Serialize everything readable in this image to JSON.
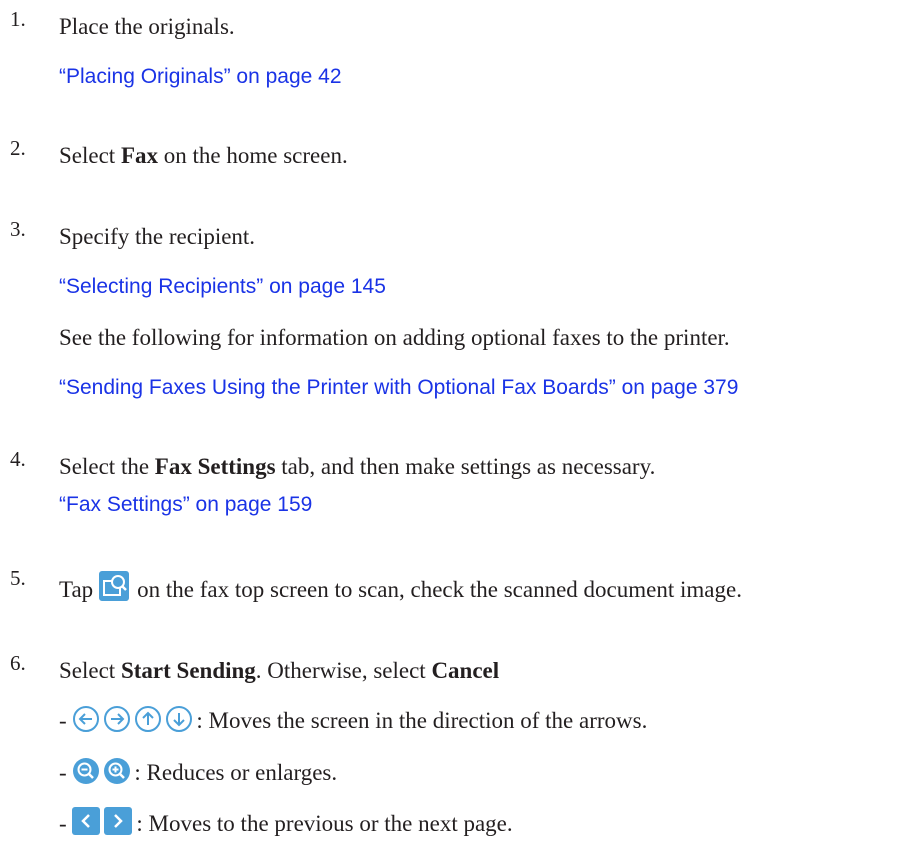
{
  "steps": [
    {
      "number": "1.",
      "text": "Place the originals.",
      "link": "“Placing Originals” on page 42"
    },
    {
      "number": "2.",
      "pre": "Select ",
      "bold": "Fax",
      "post": " on the home screen."
    },
    {
      "number": "3.",
      "text": "Specify the recipient.",
      "link1": "“Selecting Recipients” on page 145",
      "note": "See the following for information on adding optional faxes to the printer.",
      "link2": "“Sending Faxes Using the Printer with Optional Fax Boards” on page 379"
    },
    {
      "number": "4.",
      "pre": "Select the ",
      "bold": "Fax Settings",
      "post": " tab, and then make settings as necessary.",
      "link": "“Fax Settings” on page 159"
    },
    {
      "number": "5.",
      "pre": "Tap",
      "post": "on the fax top screen to scan, check the scanned document image.",
      "icon": "preview-icon"
    },
    {
      "number": "6.",
      "pre": "Select ",
      "bold1": "Start Sending",
      "mid": ". Otherwise, select ",
      "bold2": "Cancel",
      "bullets": [
        {
          "dash": "-",
          "text": ": Moves the screen in the direction of the arrows.",
          "icons": [
            "arrow-left-circle-icon",
            "arrow-right-circle-icon",
            "arrow-up-circle-icon",
            "arrow-down-circle-icon"
          ]
        },
        {
          "dash": "-",
          "text": ": Reduces or enlarges.",
          "icons": [
            "zoom-out-icon",
            "zoom-in-icon"
          ]
        },
        {
          "dash": "-",
          "text": ": Moves to the previous or the next page.",
          "icons": [
            "previous-page-icon",
            "next-page-icon"
          ]
        }
      ]
    }
  ],
  "colors": {
    "link": "#1a33e6",
    "icon": "#4a9fd8",
    "text": "#231f20"
  }
}
